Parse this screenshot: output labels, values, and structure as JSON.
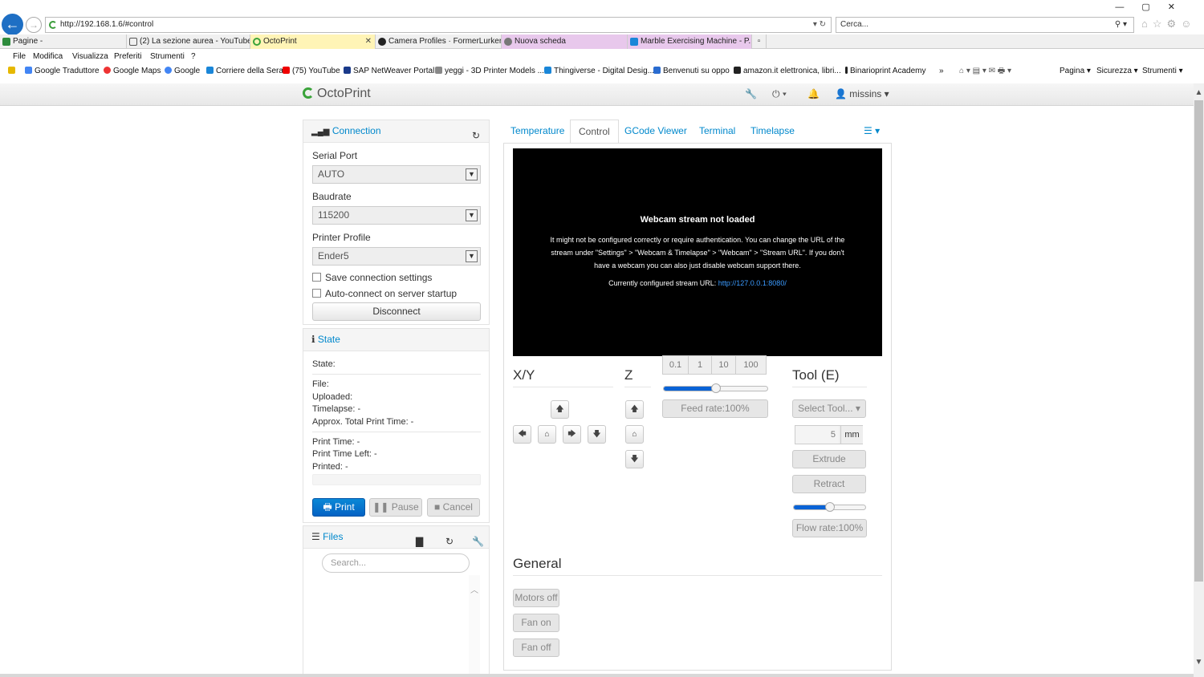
{
  "browser": {
    "url": "http://192.168.1.6/#control",
    "search_placeholder": "Cerca...",
    "tabs": [
      {
        "label": "Pagine -"
      },
      {
        "label": "(2) La sezione aurea - YouTube"
      },
      {
        "label": "OctoPrint"
      },
      {
        "label": "Camera Profiles · FormerLurker..."
      },
      {
        "label": "Nuova scheda"
      },
      {
        "label": "Marble Exercising Machine - P..."
      }
    ],
    "menu": [
      "File",
      "Modifica",
      "Visualizza",
      "Preferiti",
      "Strumenti",
      "?"
    ],
    "favorites": [
      "Google Traduttore",
      "Google Maps",
      "Google",
      "Corriere della Sera",
      "(75) YouTube",
      "SAP NetWeaver Portal",
      "yeggi - 3D Printer Models ...",
      "Thingiverse - Digital Desig...",
      "Benvenuti su oppo",
      "amazon.it elettronica, libri...",
      "Binarioprint Academy"
    ],
    "toolbar_right": [
      "Pagina",
      "Sicurezza",
      "Strumenti"
    ]
  },
  "navbar": {
    "brand": "OctoPrint",
    "user": "missins"
  },
  "connection": {
    "title": "Connection",
    "serial_port_label": "Serial Port",
    "serial_port_value": "AUTO",
    "baudrate_label": "Baudrate",
    "baudrate_value": "115200",
    "profile_label": "Printer Profile",
    "profile_value": "Ender5",
    "save_settings": "Save connection settings",
    "autoconnect": "Auto-connect on server startup",
    "disconnect": "Disconnect"
  },
  "state": {
    "title": "State",
    "state": "State:",
    "file": "File:",
    "uploaded": "Uploaded:",
    "timelapse": "Timelapse: -",
    "approx_total": "Approx. Total Print Time: -",
    "print_time": "Print Time: -",
    "print_time_left": "Print Time Left: -",
    "printed": "Printed: -",
    "print_btn": "Print",
    "pause_btn": "Pause",
    "cancel_btn": "Cancel"
  },
  "files": {
    "title": "Files",
    "search_placeholder": "Search..."
  },
  "main_tabs": [
    "Temperature",
    "Control",
    "GCode Viewer",
    "Terminal",
    "Timelapse"
  ],
  "webcam": {
    "title": "Webcam stream not loaded",
    "message": "It might not be configured correctly or require authentication. You can change the URL of the stream under \"Settings\" > \"Webcam & Timelapse\" > \"Webcam\" > \"Stream URL\". If you don't have a webcam you can also just disable webcam support there.",
    "url_label": "Currently configured stream URL:",
    "url": "http://127.0.0.1:8080/"
  },
  "control": {
    "xy_title": "X/Y",
    "z_title": "Z",
    "tool_title": "Tool (E)",
    "step_sizes": [
      "0.1",
      "1",
      "10",
      "100"
    ],
    "feed_rate": "Feed rate:100%",
    "feed_rate_fraction": 0.5,
    "select_tool": "Select Tool...",
    "extrude_amount": "5",
    "extrude_unit": "mm",
    "extrude": "Extrude",
    "retract": "Retract",
    "flow_rate": "Flow rate:100%",
    "flow_rate_fraction": 0.5,
    "general_title": "General",
    "motors_off": "Motors off",
    "fan_on": "Fan on",
    "fan_off": "Fan off"
  }
}
